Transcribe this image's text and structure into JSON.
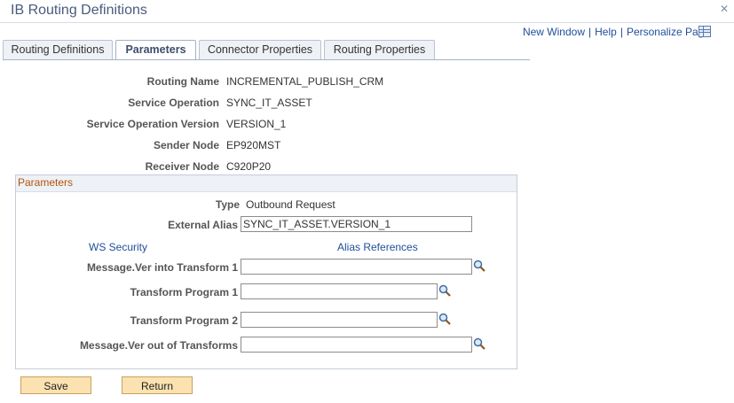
{
  "window": {
    "title": "IB Routing Definitions"
  },
  "top_links": {
    "new_window": "New Window",
    "help": "Help",
    "personalize": "Personalize Page",
    "separator": "|"
  },
  "tabs": [
    {
      "label": "Routing Definitions",
      "active": false
    },
    {
      "label": "Parameters",
      "active": true
    },
    {
      "label": "Connector Properties",
      "active": false
    },
    {
      "label": "Routing Properties",
      "active": false
    }
  ],
  "routing": {
    "routing_name_label": "Routing Name",
    "routing_name": "INCREMENTAL_PUBLISH_CRM",
    "service_operation_label": "Service Operation",
    "service_operation": "SYNC_IT_ASSET",
    "service_operation_version_label": "Service Operation Version",
    "service_operation_version": "VERSION_1",
    "sender_node_label": "Sender Node",
    "sender_node": "EP920MST",
    "receiver_node_label": "Receiver Node",
    "receiver_node": "C920P20"
  },
  "parameters": {
    "group_title": "Parameters",
    "type_label": "Type",
    "type_value": "Outbound Request",
    "external_alias_label": "External Alias",
    "external_alias_value": "SYNC_IT_ASSET.VERSION_1",
    "ws_security_link": "WS Security",
    "alias_references_link": "Alias References",
    "msg_ver_into_label": "Message.Ver into Transform 1",
    "msg_ver_into_value": "",
    "transform_program_1_label": "Transform Program 1",
    "transform_program_1_value": "",
    "transform_program_2_label": "Transform Program 2",
    "transform_program_2_value": "",
    "msg_ver_out_label": "Message.Ver out of Transforms",
    "msg_ver_out_value": ""
  },
  "buttons": {
    "save": "Save",
    "return": "Return"
  },
  "icons": {
    "close": "close-icon",
    "lookup": "magnifier-icon",
    "personalize_grid": "grid-icon"
  }
}
